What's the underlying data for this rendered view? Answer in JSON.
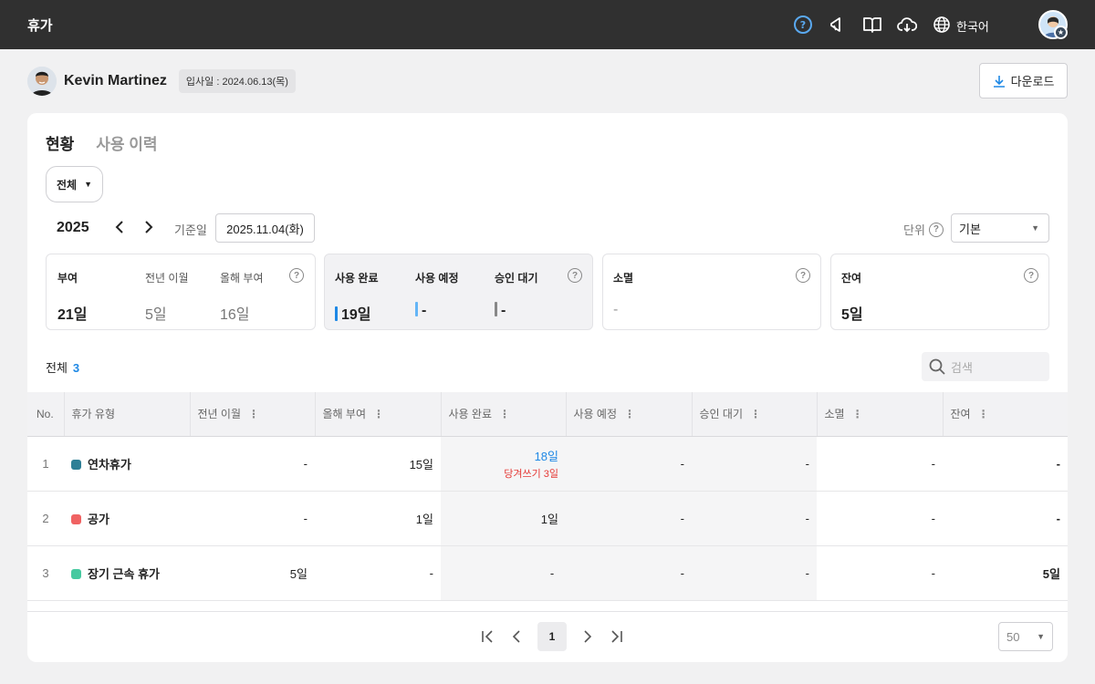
{
  "header": {
    "title": "휴가",
    "language": "한국어"
  },
  "user": {
    "name": "Kevin Martinez",
    "hire_date": "입사일 : 2024.06.13(목)"
  },
  "download_label": "다운로드",
  "tabs": [
    {
      "label": "현황",
      "active": true
    },
    {
      "label": "사용 이력",
      "active": false
    }
  ],
  "filter": {
    "label": "전체"
  },
  "year": "2025",
  "reference": {
    "label": "기준일",
    "date": "2025.11.04(화)"
  },
  "unit": {
    "label": "단위",
    "value": "기본"
  },
  "summary": {
    "grant": {
      "label": "부여",
      "value": "21일",
      "carry_label": "전년 이월",
      "carry_value": "5일",
      "this_year_label": "올해 부여",
      "this_year_value": "16일"
    },
    "usage": {
      "used_label": "사용 완료",
      "used_value": "19일",
      "planned_label": "사용 예정",
      "planned_value": "-",
      "pending_label": "승인 대기",
      "pending_value": "-"
    },
    "expired": {
      "label": "소멸",
      "value": "-"
    },
    "remaining": {
      "label": "잔여",
      "value": "5일"
    }
  },
  "list": {
    "total_label": "전체",
    "total_count": "3",
    "search_placeholder": "검색"
  },
  "table": {
    "columns": [
      "No.",
      "휴가 유형",
      "전년 이월",
      "올해 부여",
      "사용 완료",
      "사용 예정",
      "승인 대기",
      "소멸",
      "잔여"
    ],
    "rows": [
      {
        "no": "1",
        "type": "연차휴가",
        "color": "#2e7f96",
        "carry": "-",
        "grant": "15일",
        "used": "18일",
        "used_note": "당겨쓰기 3일",
        "planned": "-",
        "pending": "-",
        "expired": "-",
        "remaining": "-"
      },
      {
        "no": "2",
        "type": "공가",
        "color": "#f06262",
        "carry": "-",
        "grant": "1일",
        "used": "1일",
        "used_note": "",
        "planned": "-",
        "pending": "-",
        "expired": "-",
        "remaining": "-"
      },
      {
        "no": "3",
        "type": "장기 근속 휴가",
        "color": "#46c9a0",
        "carry": "5일",
        "grant": "-",
        "used": "-",
        "used_note": "",
        "planned": "-",
        "pending": "-",
        "expired": "-",
        "remaining": "5일"
      }
    ]
  },
  "pagination": {
    "current": "1",
    "page_size": "50"
  },
  "colors": {
    "accent": "#1e88e5",
    "topbar": "#303030",
    "used_bar": "#1e88e5",
    "planned_bar": "#64b5f6",
    "pending_bar": "#888888"
  }
}
